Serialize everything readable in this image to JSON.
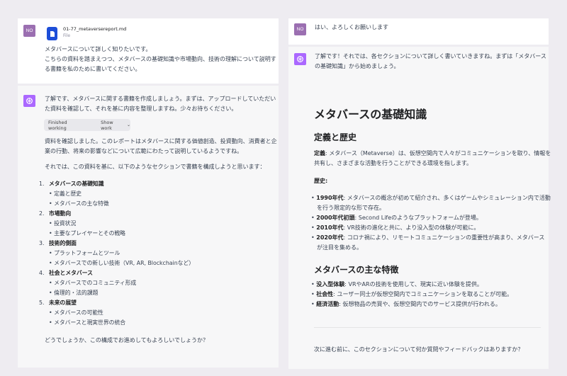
{
  "left": {
    "user_message": {
      "avatar": "NO",
      "file_name": "01-77_metaversereport.md",
      "file_type": "File",
      "lines": [
        "メタバースについて詳しく知りたいです。",
        "こちらの資料を踏まえつつ、メタバースの基礎知識や市場動向、技術の理解について説明す",
        "る書籍を私のために書いてください。"
      ]
    },
    "assistant_message": {
      "intro": [
        "了解です、メタバースに関する書籍を作成しましょう。まずは、アップロードしていただい",
        "た資料を確認して、それを基に内容を整理しますね。少々お待ちください。"
      ],
      "status_chip": "Finished working",
      "show_work": "Show work",
      "para2": [
        "資料を確認しました。このレポートはメタバースに関する価値創造、投資動向、消費者と企",
        "業の行動、将来の影響などについて広範にわたって説明しているようですね。"
      ],
      "para3": "それでは、この資料を基に、以下のようなセクションで書籍を構成しようと思います：",
      "sections": [
        {
          "num": "1.",
          "title": "メタバースの基礎知識",
          "items": [
            "定義と歴史",
            "メタバースの主な特徴"
          ]
        },
        {
          "num": "2.",
          "title": "市場動向",
          "items": [
            "投資状況",
            "主要なプレイヤーとその戦略"
          ]
        },
        {
          "num": "3.",
          "title": "技術的側面",
          "items": [
            "プラットフォームとツール",
            "メタバースでの新しい技術（VR, AR, Blockchainなど）"
          ]
        },
        {
          "num": "4.",
          "title": "社会とメタバース",
          "items": [
            "メタバースでのコミュニティ形成",
            "倫理的・法的課題"
          ]
        },
        {
          "num": "5.",
          "title": "未来の展望",
          "items": [
            "メタバースの可能性",
            "メタバースと現実世界の統合"
          ]
        }
      ],
      "closing": "どうでしょうか、この構成でお進めしてもよろしいでしょうか？"
    }
  },
  "right": {
    "user_message": {
      "avatar": "NO",
      "text": "はい、よろしくお願いします"
    },
    "assistant_message": {
      "intro": [
        "了解です！それでは、各セクションについて詳しく書いていきますね。まずは「メタバース",
        "の基礎知識」から始めましょう。"
      ],
      "h1": "メタバースの基礎知識",
      "h2_history": "定義と歴史",
      "def_label": "定義",
      "def_text": [
        ": メタバース（Metaverse）は、仮想空間内で人々がコミュニケーションを取り、情報を",
        "共有し、さまざまな活動を行うことができる環境を指します。"
      ],
      "history_label": "歴史",
      "history_items": [
        {
          "label": "1990年代",
          "lines": [
            ": メタバースの概念が初めて紹介され、多くはゲームやシミュレーション内で活動",
            "を行う限定的な形で存在。"
          ]
        },
        {
          "label": "2000年代初頭",
          "lines": [
            ": Second Lifeのようなプラットフォームが登場。"
          ]
        },
        {
          "label": "2010年代",
          "lines": [
            ": VR技術の進化と共に、より没入型の体験が可能に。"
          ]
        },
        {
          "label": "2020年代",
          "lines": [
            ": コロナ禍により、リモートコミュニケーションの重要性が高まり、メタバース",
            "が注目を集める。"
          ]
        }
      ],
      "h2_features": "メタバースの主な特徴",
      "feature_items": [
        {
          "label": "没入型体験",
          "text": ": VRやARの技術を使用して、現実に近い体験を提供。"
        },
        {
          "label": "社会性",
          "text": ": ユーザー同士が仮想空間内でコミュニケーションを取ることが可能。"
        },
        {
          "label": "経済活動",
          "text": ": 仮想物品の売買や、仮想空間内でのサービス提供が行われる。"
        }
      ],
      "closing": "次に進む前に、このセクションについて何か質問やフィードバックはありますか？"
    }
  },
  "colors": {
    "user_avatar": "#9b6fb1",
    "bot_avatar": "#ab68ff",
    "file_icon": "#1d4ed8"
  }
}
